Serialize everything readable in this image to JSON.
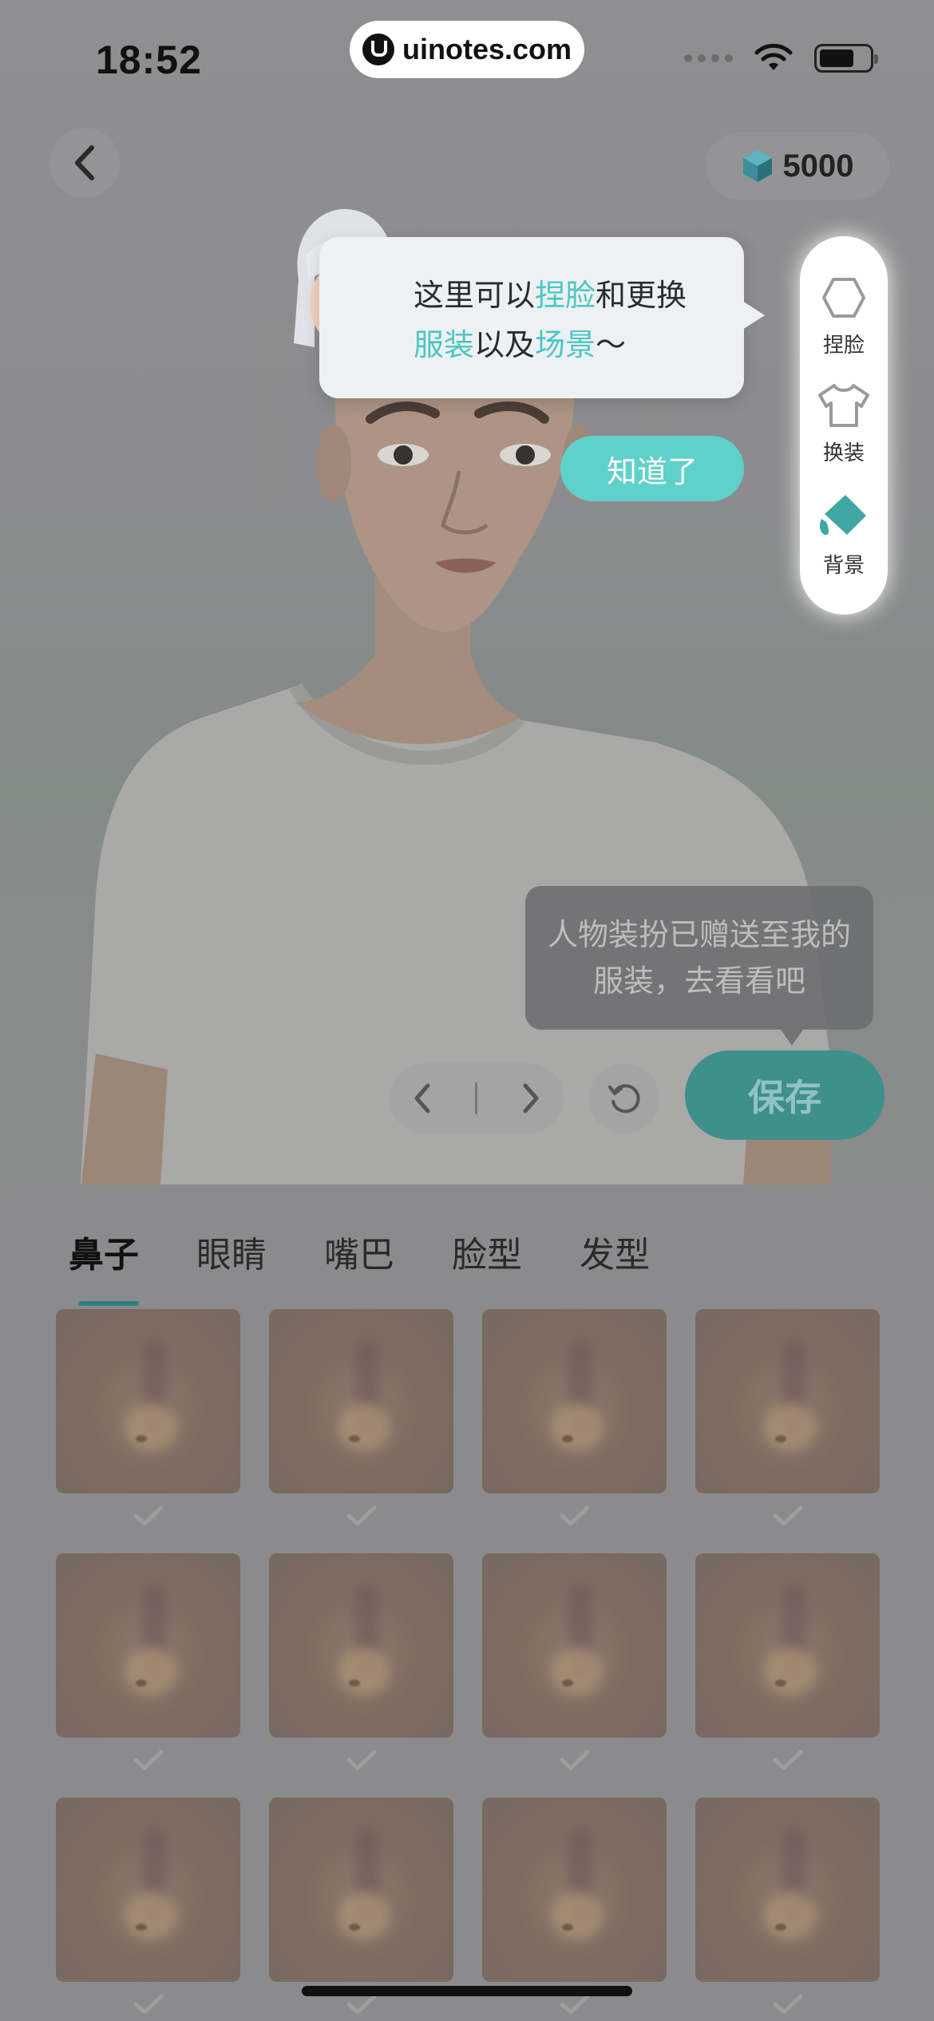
{
  "status_bar": {
    "time": "18:52"
  },
  "watermark": {
    "text": "uinotes.com"
  },
  "header": {
    "back_icon": "chevron-left-icon",
    "coins": "5000",
    "coin_icon": "cube-gem-icon"
  },
  "guide_bubble": {
    "parts": [
      {
        "text": "这里可以",
        "highlight": false
      },
      {
        "text": "捏脸",
        "highlight": true
      },
      {
        "text": "和更换",
        "highlight": false
      },
      {
        "text": "服装",
        "highlight": true
      },
      {
        "text": "以及",
        "highlight": false
      },
      {
        "text": "场景",
        "highlight": true
      },
      {
        "text": "～",
        "highlight": false
      }
    ],
    "button": "知道了"
  },
  "side_menu": {
    "items": [
      {
        "label": "捏脸",
        "icon": "face-outline-icon"
      },
      {
        "label": "换装",
        "icon": "tshirt-icon"
      },
      {
        "label": "背景",
        "icon": "paint-bucket-icon"
      }
    ]
  },
  "toast": {
    "line1": "人物装扮已赠送至我的",
    "line2": "服装，去看看吧"
  },
  "controls": {
    "save": "保存",
    "prev_icon": "chevron-left-icon",
    "next_icon": "chevron-right-icon",
    "reset_icon": "reset-icon"
  },
  "tabs": [
    "鼻子",
    "眼睛",
    "嘴巴",
    "脸型",
    "发型"
  ],
  "active_tab": 0,
  "colors": {
    "accent": "#5fd1cb",
    "highlight": "#4cc6c3",
    "save_bg": "#3f8f8d"
  }
}
